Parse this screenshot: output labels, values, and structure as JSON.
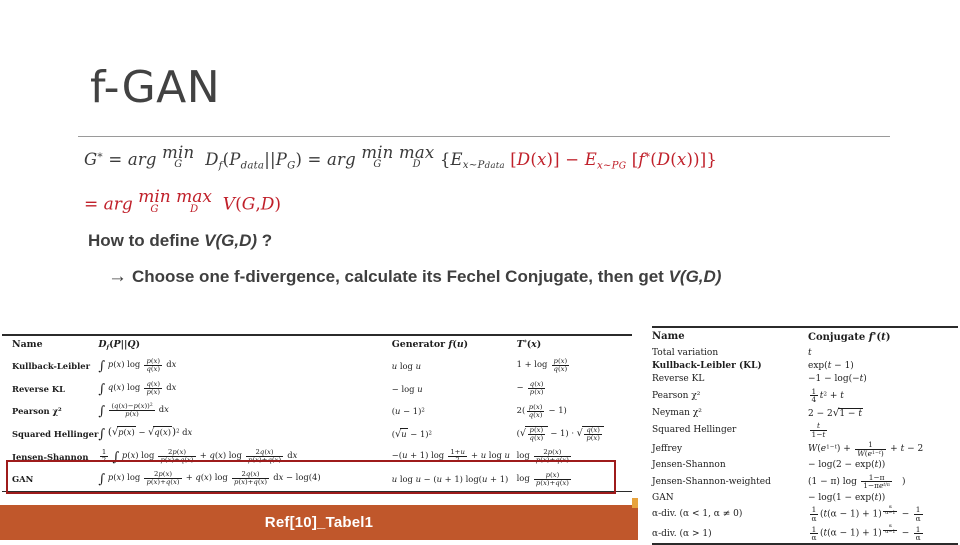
{
  "slide": {
    "title": "f-GAN",
    "caption": "Ref[10]_Tabel1",
    "colors": {
      "accent_orange": "#C0572B",
      "equation_red": "#C0202A",
      "highlight_box_red": "#9E1B1B",
      "title_gray": "#424242"
    }
  },
  "equations": {
    "line1_plain": "G* = arg min_G D_f(P_data||P_G) = arg min_G max_D {E_x~P_data[D(x)] - E_x~P_G[f*(D(x))]}",
    "line2_plain": "= arg min_G max_D V(G,D)",
    "symbols": {
      "G_star": "G",
      "star": "*",
      "equals": "=",
      "arg": "arg",
      "min": "min",
      "max": "max",
      "sub_G": "G",
      "sub_D": "D",
      "D_f": "D",
      "f": "f",
      "P_data": "P",
      "data": "data",
      "P_G": "P",
      "E": "E",
      "x_tilde": "x~",
      "D_of_x": "D(x)",
      "minus": "−",
      "f_star_D_x": "f*(D(x))",
      "V_GD": "V(G,D)"
    }
  },
  "bullets": {
    "howto_prefix": "How to define ",
    "howto_vgd": "V(G,D)",
    "howto_suffix": " ?",
    "arrow": "→",
    "choose_text": "Choose one f-divergence, calculate its Fechel Conjugate, then get ",
    "choose_vgd": "V(G,D)"
  },
  "table_left": {
    "headers": [
      "Name",
      "Df(P||Q)",
      "Generator f(u)",
      "T*(x)"
    ],
    "rows": [
      {
        "name": "Kullback-Leibler",
        "highlight": false
      },
      {
        "name": "Reverse KL",
        "highlight": false
      },
      {
        "name": "Pearson χ²",
        "highlight": false
      },
      {
        "name": "Squared Hellinger",
        "highlight": false
      },
      {
        "name": "Jensen-Shannon",
        "highlight": false
      },
      {
        "name": "GAN",
        "highlight": true
      }
    ],
    "df_plain": [
      "∫ p(x) log p(x)/q(x) dx",
      "∫ q(x) log q(x)/p(x) dx",
      "∫ (q(x)-p(x))²/p(x) dx",
      "∫ (√p(x) - √q(x))² dx",
      "½ ∫ p(x) log 2p(x)/(p(x)+q(x)) + q(x) log 2q(x)/(p(x)+q(x)) dx",
      "∫ p(x) log 2p(x)/(p(x)+q(x)) + q(x) log 2q(x)/(p(x)+q(x)) dx - log(4)"
    ],
    "generator_plain": [
      "u log u",
      "− log u",
      "(u − 1)²",
      "(√u − 1)²",
      "−(u + 1) log (1+u)/2 + u log u",
      "u log u − (u + 1) log(u + 1)"
    ],
    "tstar_plain": [
      "1 + log p(x)/q(x)",
      "− q(x)/p(x)",
      "2(p(x)/q(x) − 1)",
      "(√(p(x)/q(x)) − 1) · √(q(x)/p(x))",
      "log 2p(x)/(p(x)+q(x))",
      "log p(x)/(p(x)+q(x))"
    ]
  },
  "table_right": {
    "headers": [
      "Name",
      "Conjugate f*(t)"
    ],
    "rows": [
      {
        "name": "Total variation",
        "bold": false,
        "conj_plain": "t"
      },
      {
        "name": "Kullback-Leibler (KL)",
        "bold": true,
        "conj_plain": "exp(t − 1)"
      },
      {
        "name": "Reverse KL",
        "bold": false,
        "conj_plain": "−1 − log(−t)"
      },
      {
        "name": "Pearson χ²",
        "bold": false,
        "conj_plain": "¼ t² + t"
      },
      {
        "name": "Neyman χ²",
        "bold": false,
        "conj_plain": "2 − 2√(1 − t)"
      },
      {
        "name": "Squared Hellinger",
        "bold": false,
        "conj_plain": "t/(1 − t)"
      },
      {
        "name": "Jeffrey",
        "bold": false,
        "conj_plain": "W(e^(1−t)) + 1/W(e^(1−t)) + t − 2"
      },
      {
        "name": "Jensen-Shannon",
        "bold": false,
        "conj_plain": "− log(2 − exp(t))"
      },
      {
        "name": "Jensen-Shannon-weighted",
        "bold": false,
        "conj_plain": "(1 − π) log (1−π)/(1−πe^(t/π))"
      },
      {
        "name": "GAN",
        "bold": false,
        "conj_plain": "− log(1 − exp(t))"
      },
      {
        "name": "α-div. (α < 1, α ≠ 0)",
        "bold": false,
        "conj_plain": "1/α (t(α−1)+1)^(α/(α−1)) − 1/α"
      },
      {
        "name": "α-div. (α > 1)",
        "bold": false,
        "conj_plain": "1/α (t(α−1)+1)^(α/(α−1)) − 1/α"
      }
    ]
  }
}
